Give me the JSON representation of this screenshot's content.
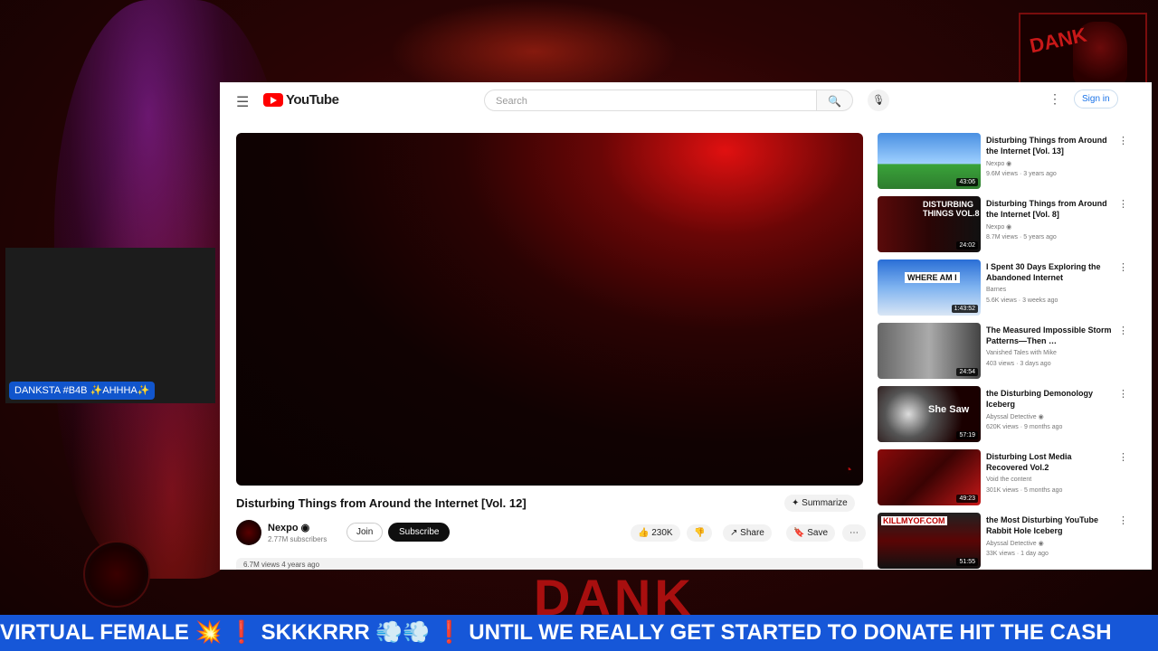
{
  "overlay": {
    "cam_label": "DANKSTA #B4B ✨AHHHA✨",
    "corner_logo_text": "DANK",
    "background_text": "DANK",
    "ticker": "VIRTUAL FEMALE 💥 ❗ SKKKRRR 💨💨 ❗ UNTIL WE REALLY GET STARTED TO DONATE HIT THE CASH"
  },
  "header": {
    "menu_icon": "☰",
    "brand": "YouTube",
    "search_placeholder": "Search",
    "search_icon": "🔍",
    "mic_icon": "🎙",
    "more_icon": "⋮",
    "signin": "Sign in"
  },
  "video": {
    "title": "Disturbing Things from Around the Internet [Vol. 12]",
    "summarize": "✦ Summarize",
    "channel": "Nexpo ◉",
    "subscribers": "2.77M subscribers",
    "join": "Join",
    "subscribe": "Subscribe",
    "likes": "👍 230K",
    "dislike": "👎",
    "share": "↗ Share",
    "save": "🔖 Save",
    "more": "⋯",
    "meta": "6.7M views  4 years ago",
    "player_mark": "◔"
  },
  "recommendations": [
    {
      "title": "Disturbing Things from Around the Internet [Vol. 13]",
      "channel": "Nexpo ◉",
      "meta": "9.6M views · 3 years ago",
      "duration": "43:06",
      "thumb_text": ""
    },
    {
      "title": "Disturbing Things from Around the Internet [Vol. 8]",
      "channel": "Nexpo ◉",
      "meta": "8.7M views · 5 years ago",
      "duration": "24:02",
      "thumb_text": "DISTURBING THINGS VOL.8"
    },
    {
      "title": "I Spent 30 Days Exploring the Abandoned Internet",
      "channel": "Barnes",
      "meta": "5.6K views · 3 weeks ago",
      "duration": "1:43:52",
      "thumb_text": "WHERE AM I"
    },
    {
      "title": "The Measured Impossible Storm Patterns—Then …",
      "channel": "Vanished Tales with Mike",
      "meta": "403 views · 3 days ago",
      "duration": "24:54",
      "thumb_text": ""
    },
    {
      "title": "the Disturbing Demonology Iceberg",
      "channel": "Abyssal Detective ◉",
      "meta": "620K views · 9 months ago",
      "duration": "57:19",
      "thumb_text": "She Saw"
    },
    {
      "title": "Disturbing Lost Media Recovered Vol.2",
      "channel": "Void the content",
      "meta": "301K views · 5 months ago",
      "duration": "49:23",
      "thumb_text": ""
    },
    {
      "title": "the Most Disturbing YouTube Rabbit Hole Iceberg",
      "channel": "Abyssal Detective ◉",
      "meta": "33K views · 1 day ago",
      "duration": "51:55",
      "thumb_text": "KILLMYOF.COM"
    }
  ]
}
